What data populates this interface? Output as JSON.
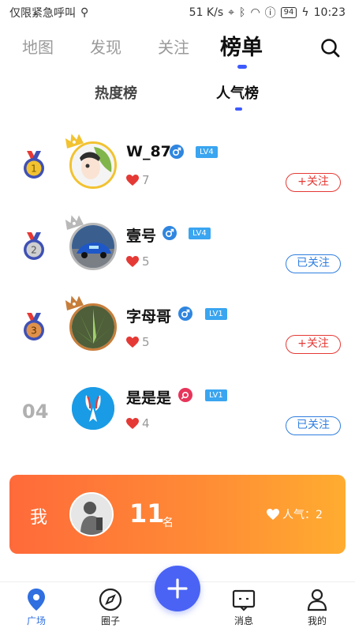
{
  "status_bar": {
    "left_text": "仅限紧急呼叫",
    "speed": "51 K/s",
    "battery": "94",
    "time": "10:23"
  },
  "top_tabs": [
    {
      "label": "地图",
      "active": false
    },
    {
      "label": "发现",
      "active": false
    },
    {
      "label": "关注",
      "active": false
    },
    {
      "label": "榜单",
      "active": true
    }
  ],
  "sub_tabs": [
    {
      "label": "热度榜",
      "active": false
    },
    {
      "label": "人气榜",
      "active": true
    }
  ],
  "rankings": [
    {
      "rank": "1",
      "name": "W_87",
      "gender": "male",
      "level": "LV4",
      "likes": "7",
      "follow_label": "+关注",
      "followed": false
    },
    {
      "rank": "2",
      "name": "壹号",
      "gender": "male",
      "level": "LV4",
      "likes": "5",
      "follow_label": "已关注",
      "followed": true
    },
    {
      "rank": "3",
      "name": "字母哥",
      "gender": "male",
      "level": "LV1",
      "likes": "5",
      "follow_label": "+关注",
      "followed": false
    },
    {
      "rank": "04",
      "name": "是是是",
      "gender": "female",
      "level": "LV1",
      "likes": "4",
      "follow_label": "已关注",
      "followed": true
    }
  ],
  "my_card": {
    "label": "我",
    "rank": "11",
    "rank_unit": "名",
    "popularity": "人气：2"
  },
  "bottom_nav": [
    {
      "label": "广场",
      "active": true
    },
    {
      "label": "圈子",
      "active": false
    },
    {
      "label": "消息",
      "active": false
    },
    {
      "label": "我的",
      "active": false
    }
  ],
  "colors": {
    "accent": "#3d5afe",
    "follow_red": "#e53935",
    "followed_blue": "#2f7ee0",
    "gold": "#f2c230",
    "silver": "#b8b8b8",
    "bronze": "#c77d3a"
  }
}
